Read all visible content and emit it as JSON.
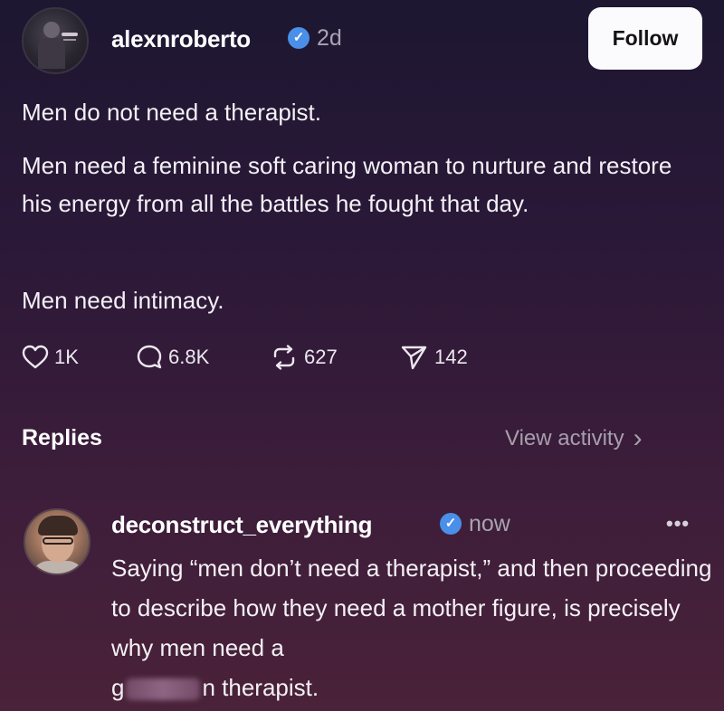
{
  "post": {
    "username": "alexnroberto",
    "timestamp": "2d",
    "follow_label": "Follow",
    "paragraphs": [
      "Men do not need a therapist.",
      "Men need a feminine soft caring woman to nurture and restore his energy from all the battles he fought that day.",
      "Men need intimacy."
    ],
    "actions": {
      "likes": "1K",
      "replies": "6.8K",
      "reposts": "627",
      "shares": "142"
    },
    "icons": {
      "verified": "verified-badge-icon",
      "like": "heart-icon",
      "reply": "comment-bubble-icon",
      "repost": "repost-icon",
      "share": "send-icon"
    }
  },
  "replies_section": {
    "heading": "Replies",
    "view_activity_label": "View activity",
    "chevron": "›"
  },
  "reply": {
    "username": "deconstruct_everything",
    "timestamp": "now",
    "more_label": "•••",
    "text_main": "Saying “men don’t need a therapist,” and then proceeding to describe how they need a mother figure, is precisely why men need a",
    "text_start": "g",
    "text_end": "n therapist."
  },
  "colors": {
    "verified": "#4a8fe8",
    "follow_bg": "#fbfafc",
    "muted_text": "#a9a3b2"
  }
}
